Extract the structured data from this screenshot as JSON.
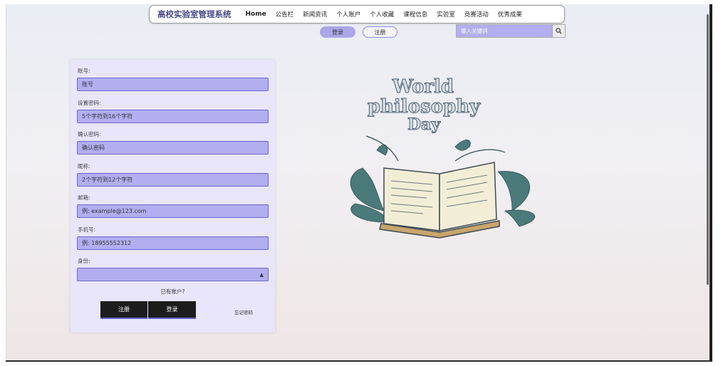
{
  "nav": {
    "brand": "高校实验室管理系统",
    "items": [
      "Home",
      "公告栏",
      "新闻资讯",
      "个人账户",
      "个人收藏",
      "课程信息",
      "实验室",
      "竞赛活动",
      "优秀成果"
    ]
  },
  "auth": {
    "login_label": "登录",
    "register_label": "注册"
  },
  "search": {
    "placeholder": "输入关键词",
    "icon": "search-icon"
  },
  "form": {
    "account_label": "账号:",
    "account_placeholder": "账号",
    "password_label": "设置密码:",
    "password_placeholder": "5个字符到16个字符",
    "confirm_label": "确认密码:",
    "confirm_placeholder": "确认密码",
    "nickname_label": "昵称:",
    "nickname_placeholder": "2个字符到12个字符",
    "email_label": "邮箱:",
    "email_placeholder": "例: example@123.com",
    "phone_label": "手机号:",
    "phone_placeholder": "例: 18955552312",
    "identity_label": "身份:",
    "identity_value": "",
    "have_account": "已有账户?",
    "register_button": "注册",
    "login_button": "登录",
    "forgot": "忘记密码"
  },
  "illustration": {
    "title_lines": [
      "World",
      "philosophy",
      "Day"
    ]
  },
  "colors": {
    "accent": "#b2aef0",
    "accent_border": "#6c66c7",
    "card_bg": "#e9e5fb",
    "dark_button": "#1c1c1c"
  }
}
